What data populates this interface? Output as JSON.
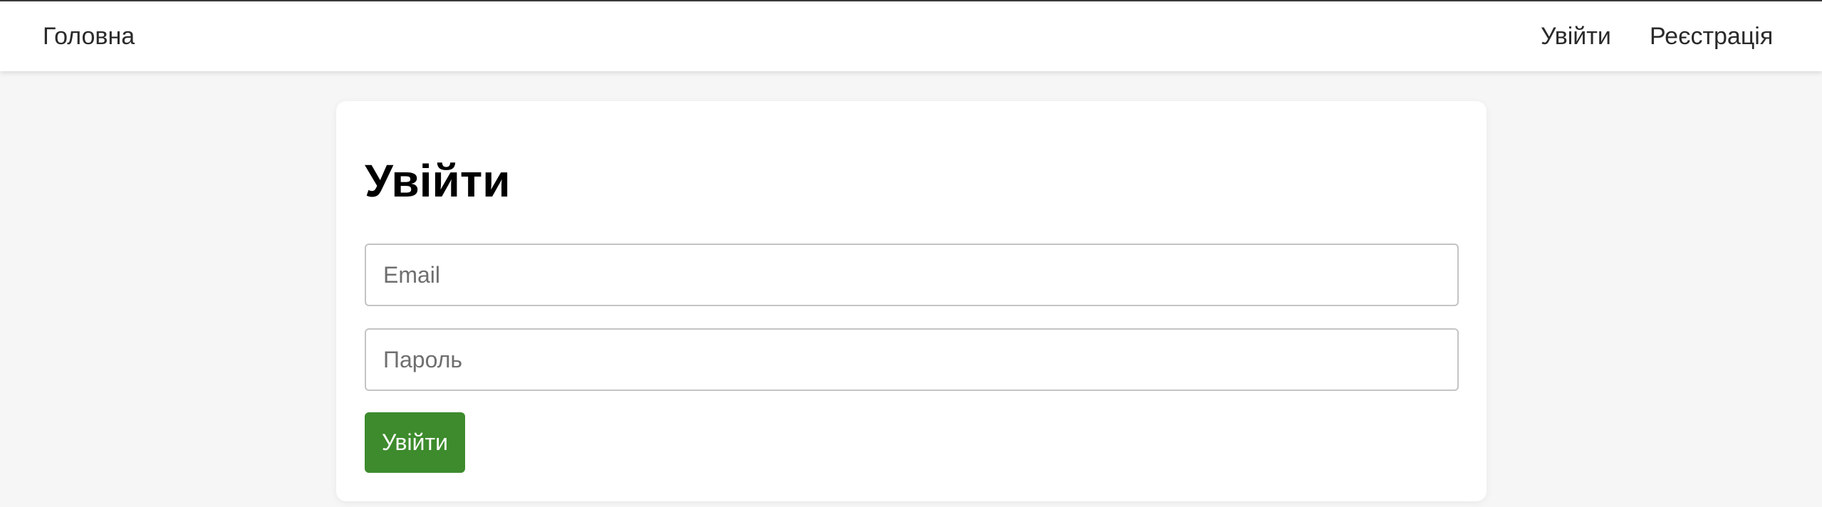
{
  "navbar": {
    "home_label": "Головна",
    "login_label": "Увійти",
    "register_label": "Реєстрація"
  },
  "login_form": {
    "title": "Увійти",
    "email": {
      "placeholder": "Email",
      "value": ""
    },
    "password": {
      "placeholder": "Пароль",
      "value": ""
    },
    "submit_label": "Увійти"
  },
  "colors": {
    "page_background": "#f6f6f6",
    "card_background": "#ffffff",
    "submit_button": "#3d8b2d",
    "text": "#222222"
  }
}
